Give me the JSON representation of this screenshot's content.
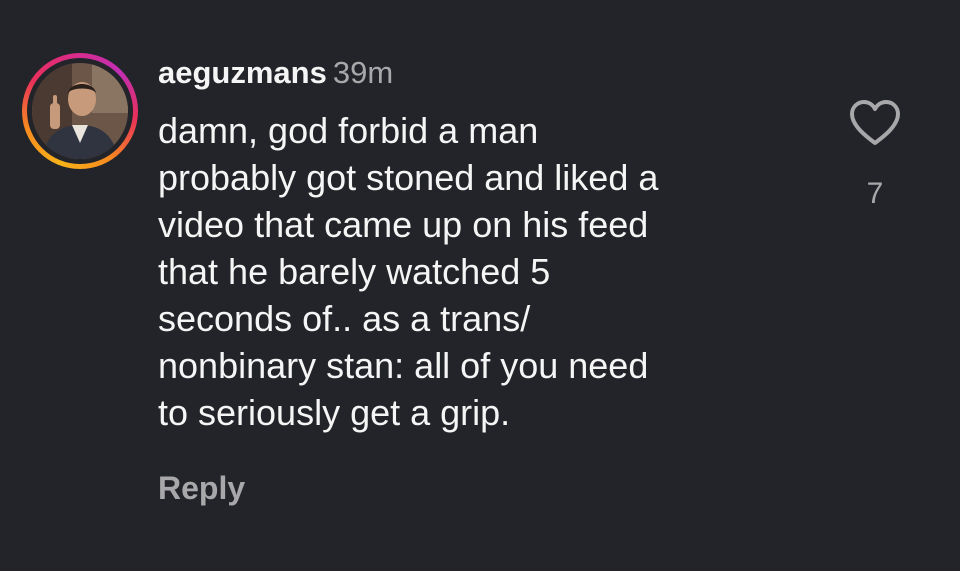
{
  "comment": {
    "username": "aeguzmans",
    "time": "39m",
    "lines": [
      "damn, god forbid a man",
      "probably got stoned and liked a",
      "video that came up on his feed",
      "that he barely watched 5",
      "seconds of.. as a trans/",
      "nonbinary stan: all of you need",
      "to seriously get a grip."
    ],
    "reply_label": "Reply",
    "like_count": "7",
    "like_icon": "heart-outline-icon"
  },
  "colors": {
    "background": "#232429",
    "primary_text": "#f5f5f5",
    "secondary_text": "#a8a8ab"
  }
}
